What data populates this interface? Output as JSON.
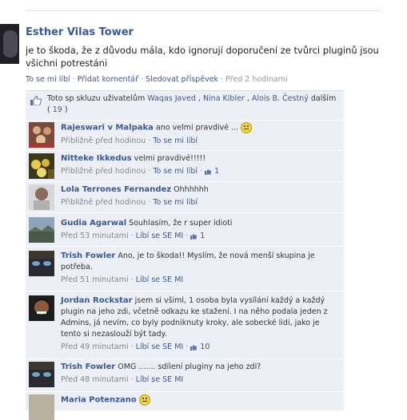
{
  "post": {
    "author": "Esther Vilas Tower",
    "text": "je to škoda, že z důvodu mála, kdo ignorují doporučení ze tvůrci pluginů jsou všichni potrestáni",
    "actions": {
      "like": "To se mi líbí",
      "comment": "Přidat komentář",
      "follow": "Sledovat příspěvek",
      "time": "Před 2 hodinami"
    }
  },
  "likes": {
    "prefix": "Toto sp skluzu uživatelům",
    "users": [
      "Waqas Javed",
      "Nina Kibler",
      "Alois B. Čestný"
    ],
    "suffix": "dalším",
    "more_count": "19"
  },
  "comments": [
    {
      "author": "Rajeswari v Malpaka",
      "text": "ano velmi pravdivé ...",
      "smiley": true,
      "time": "Přibližně před hodinou",
      "action": "To se mi líbí",
      "likes": ""
    },
    {
      "author": "Nitteke Ikkedus",
      "text": "velmi pravdivé!!!!!",
      "smiley": false,
      "time": "Přibližně před hodinou",
      "action": "To se mi líbí",
      "likes": "1"
    },
    {
      "author": "Lola Terrones Fernandez",
      "text": "Ohhhhhh",
      "smiley": false,
      "time": "Přibližně před hodinou",
      "action": "To se mi líbí",
      "likes": ""
    },
    {
      "author": "Gudia Agarwal",
      "text": "Souhlasím, že r super idioti",
      "smiley": false,
      "time": "Před 53 minutami",
      "action": "Líbí se SE MI",
      "likes": "1"
    },
    {
      "author": "Trish Fowler",
      "text": "Ano, je to škoda!! Myslím, že nová menší skupina je potřeba.",
      "smiley": false,
      "time": "Před 51 minutami",
      "action": "Líbí se SE MI",
      "likes": ""
    },
    {
      "author": "Jordan Rockstar",
      "text": "jsem si všiml, 1 osoba byla vysílání každý a každý plugin na jeho zdi, včetně odkazu ke stažení. I na něho podala jeden z Admins, já nevím, co byly podniknuty kroky, ale sobecké lidi, jako je tento si nezaslouží být tady.",
      "smiley": false,
      "time": "Před 49 minutami",
      "action": "Líbí se SE MI",
      "likes": "10"
    },
    {
      "author": "Trish Fowler",
      "text": "OMG ....... sdílení pluginy na jeho zdi?",
      "smiley": false,
      "time": "Před 48 minutami",
      "action": "Líbí se SE MI",
      "likes": ""
    },
    {
      "author": "Maria Potenzano",
      "text": "",
      "smiley": true,
      "time": "",
      "action": "",
      "likes": ""
    }
  ],
  "colors": {
    "link": "#3b5998",
    "comment_bg": "#eceff5",
    "meta": "#888888"
  }
}
